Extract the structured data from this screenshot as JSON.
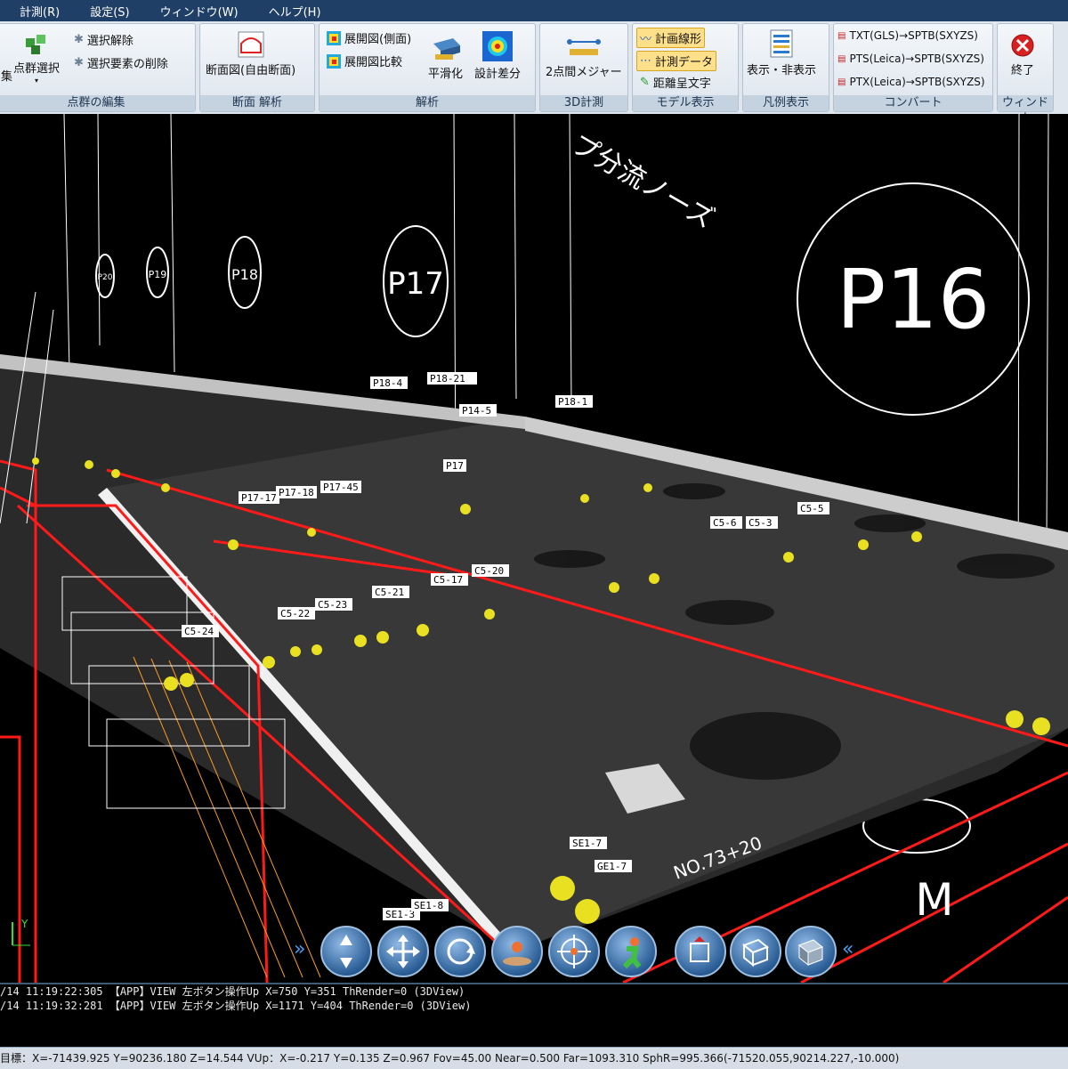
{
  "menu": [
    "計測(R)",
    "設定(S)",
    "ウィンドウ(W)",
    "ヘルプ(H)"
  ],
  "ribbon": {
    "groups": {
      "pointcloud": "点群の編集",
      "section": "断面 解析",
      "analysis": "解析",
      "measure3d": "3D計測",
      "model": "モデル表示",
      "legend": "凡例表示",
      "convert": "コンバート",
      "window": "ウィンドウ"
    },
    "buttons": {
      "select_cut": "集",
      "pc_select": "点群選択",
      "deselect": "選択解除",
      "delete_sel": "選択要素の削除",
      "section_view": "断面図(自由断面)",
      "dev_side": "展開図(側面)",
      "dev_compare": "展開図比較",
      "smooth": "平滑化",
      "design_diff": "設計差分",
      "two_point": "2点間メジャー",
      "plan_line": "計画線形",
      "measure_data": "計測データ",
      "distance_text": "距離呈文字",
      "show_hide": "表示・非表示",
      "conv_txt": "TXT(GLS)→SPTB(SXYZS)",
      "conv_pts": "PTS(Leica)→SPTB(SXYZS)",
      "conv_ptx": "PTX(Leica)→SPTB(SXYZS)",
      "exit": "終了"
    }
  },
  "scene": {
    "pier_labels": [
      "P16",
      "P17",
      "P18",
      "P19",
      "P20"
    ],
    "note": "プ分流ノーズ",
    "axis_y": "Y",
    "tags": [
      "P18-4",
      "P18-21",
      "P18-1",
      "P14-5",
      "P17",
      "P17-17",
      "P17-18",
      "P17-45",
      "C5-3",
      "C5-6",
      "C5-5",
      "C5-21",
      "C5-22",
      "C5-24",
      "C5-23",
      "C5-17",
      "C5-20",
      "SE1-7",
      "GE1-7",
      "SE1-3",
      "SE1-8",
      "NO.73+20",
      "M"
    ]
  },
  "log": [
    "/14 11:19:22:305 【APP】VIEW 左ボタン操作Up X=750 Y=351 ThRender=0 (3DView)",
    "/14 11:19:32:281 【APP】VIEW 左ボタン操作Up X=1171 Y=404 ThRender=0 (3DView)"
  ],
  "status": "目標：X=-71439.925 Y=90236.180 Z=14.544  VUp：X=-0.217 Y=0.135 Z=0.967  Fov=45.00 Near=0.500  Far=1093.310  SphR=995.366(-71520.055,90214.227,-10.000)",
  "colors": {
    "red_line": "#ff1a1a",
    "white_line": "#ffffff",
    "marker": "#e8e020",
    "orange": "#ff9a20"
  }
}
